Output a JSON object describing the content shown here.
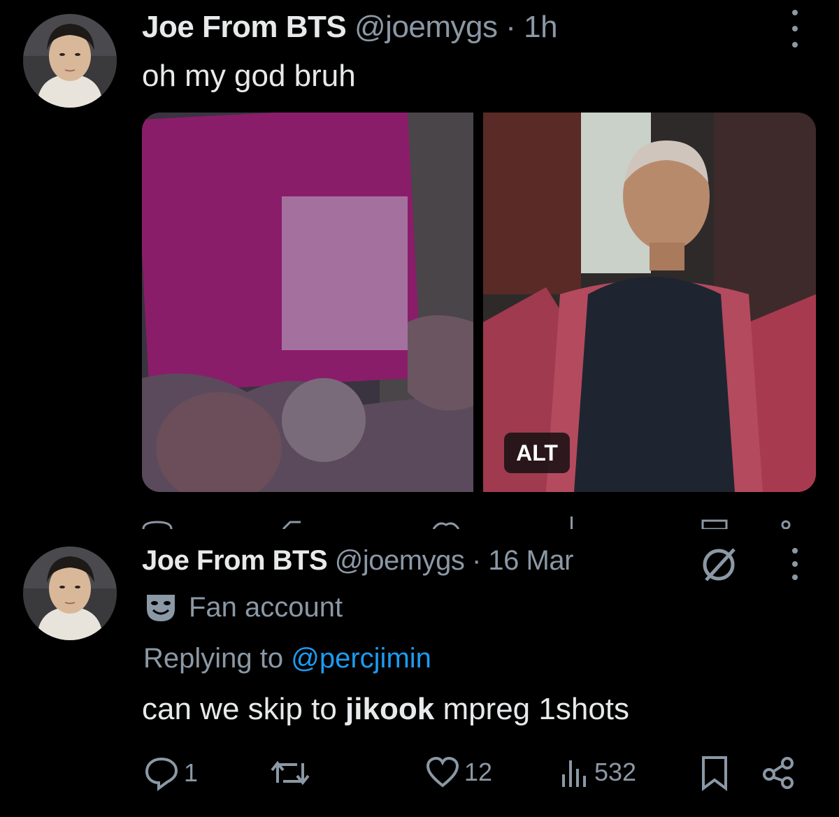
{
  "tweet1": {
    "display_name": "Joe From BTS",
    "handle": "@joemygs",
    "separator": "·",
    "time": "1h",
    "text": "oh my god bruh",
    "alt_label": "ALT"
  },
  "tweet2": {
    "display_name": "Joe From BTS",
    "handle": "@joemygs",
    "separator": "·",
    "time": "16 Mar",
    "badge_label": "Fan account",
    "replying_prefix": "Replying to",
    "replying_handle": "@percjimin",
    "text_before": "can we skip to",
    "text_bold": "jikook",
    "text_after": "mpreg 1shots",
    "replies": "1",
    "likes": "12",
    "views": "532"
  },
  "colors": {
    "background": "#000000",
    "text": "#e7e9ea",
    "muted": "#8b98a5",
    "link": "#1d9bf0"
  },
  "icons": [
    "more-icon",
    "reply-icon",
    "retweet-icon",
    "like-icon",
    "views-icon",
    "bookmark-icon",
    "share-icon",
    "mask-icon",
    "grok-icon"
  ]
}
